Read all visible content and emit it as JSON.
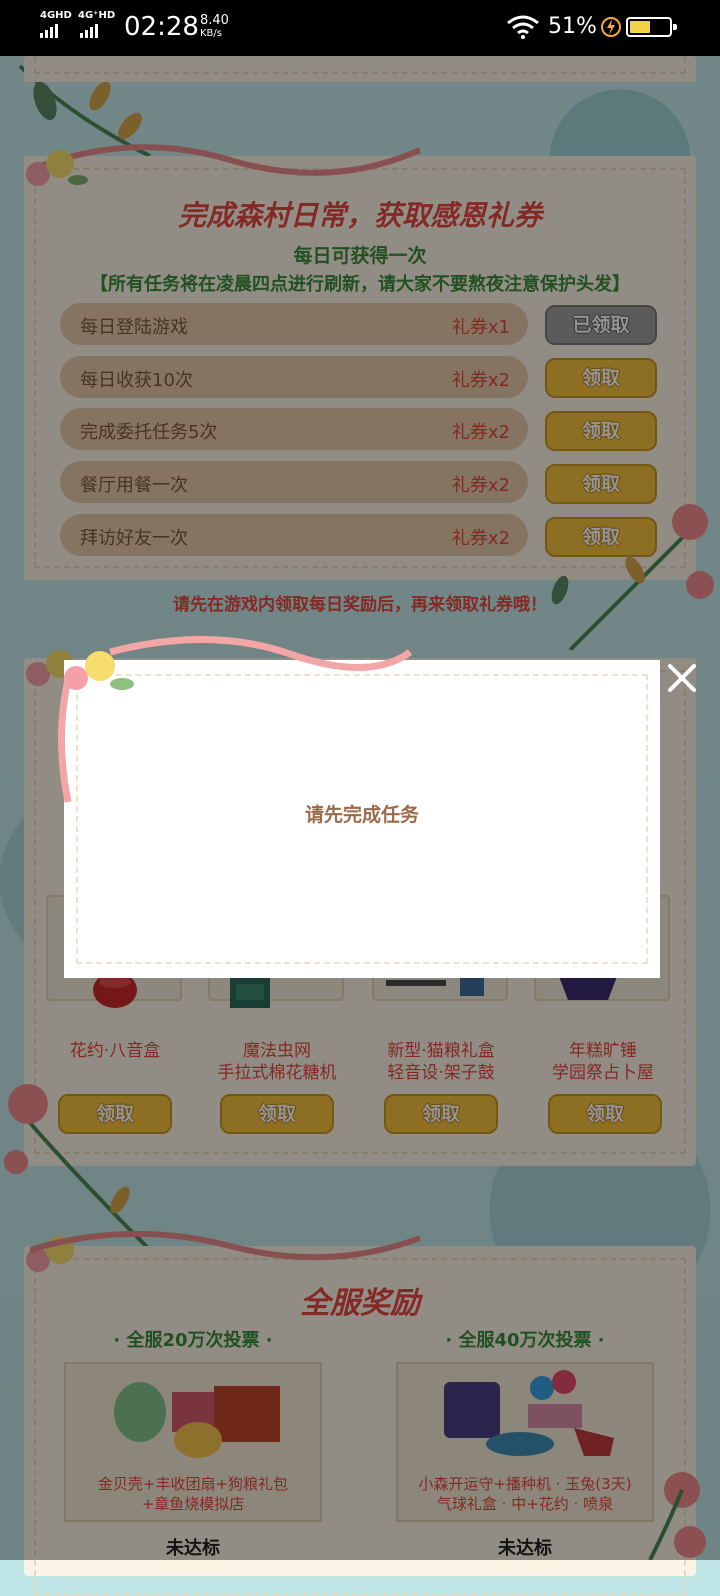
{
  "status_bar": {
    "net1": "4GHD",
    "net2": "4G⁺HD",
    "time": "02:28",
    "speed_value": "8.40",
    "speed_unit": "KB/s",
    "battery": "51%"
  },
  "daily": {
    "title": "完成森村日常，获取感恩礼券",
    "subtitle": "每日可获得一次",
    "notice": "【所有任务将在凌晨四点进行刷新，请大家不要熬夜注意保护头发】",
    "tasks": [
      {
        "name": "每日登陆游戏",
        "reward": "礼券x1",
        "button": "已领取"
      },
      {
        "name": "每日收获10次",
        "reward": "礼券x2",
        "button": "领取"
      },
      {
        "name": "完成委托任务5次",
        "reward": "礼券x2",
        "button": "领取"
      },
      {
        "name": "餐厅用餐一次",
        "reward": "礼券x2",
        "button": "领取"
      },
      {
        "name": "拜访好友一次",
        "reward": "礼券x2",
        "button": "领取"
      }
    ],
    "footer_note": "请先在游戏内领取每日奖励后，再来领取礼券哦！"
  },
  "prizes": {
    "items": [
      {
        "line1": "花约·八音盒",
        "line2": "",
        "button": "领取"
      },
      {
        "line1": "魔法虫网",
        "line2": "手拉式棉花糖机",
        "button": "领取"
      },
      {
        "line1": "新型·猫粮礼盒",
        "line2": "轻音设·架子鼓",
        "button": "领取"
      },
      {
        "line1": "年糕旷锤",
        "line2": "学园祭占卜屋",
        "button": "领取"
      }
    ]
  },
  "server": {
    "title": "全服奖励",
    "left": {
      "head": "· 全服20万次投票 ·",
      "desc1": "金贝壳+丰收团扇+狗粮礼包",
      "desc2": "+章鱼烧模拟店",
      "status": "未达标"
    },
    "right": {
      "head": "· 全服40万次投票 ·",
      "desc1": "小森开运守+播种机 · 玉兔(3天)",
      "desc2": "气球礼盒 · 中+花约 · 喷泉",
      "status": "未达标"
    }
  },
  "modal": {
    "message": "请先完成任务",
    "close_icon": "close-icon"
  }
}
